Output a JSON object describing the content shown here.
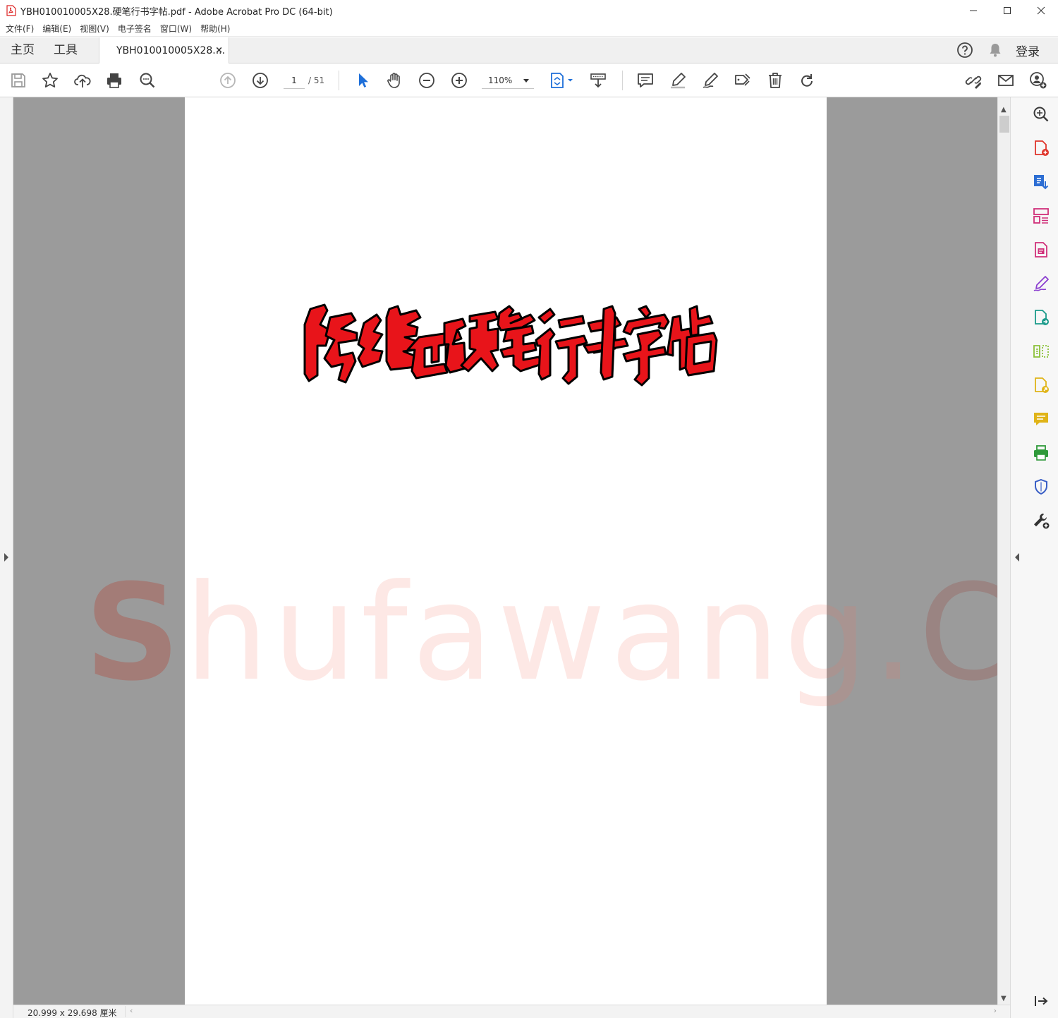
{
  "window": {
    "title": "YBH010010005X28.硬笔行书字帖.pdf - Adobe Acrobat Pro DC (64-bit)",
    "controls": {
      "minimize": "─",
      "maximize": "☐",
      "close": "✕"
    }
  },
  "menu": [
    "文件(F)",
    "编辑(E)",
    "视图(V)",
    "电子签名",
    "窗口(W)",
    "帮助(H)"
  ],
  "tabs": {
    "home": "主页",
    "tools": "工具",
    "document": "YBH010010005X28....",
    "close_glyph": "×",
    "login": "登录"
  },
  "toolbar": {
    "current_page": "1",
    "total_pages": "/ 51",
    "zoom": "110%"
  },
  "document": {
    "title_calligraphy": "陈维世硬笔行书字帖",
    "title_color": "#e8141a"
  },
  "watermark": {
    "first": "S",
    "middle": "hufawang",
    "dot": ".",
    "last": "CN"
  },
  "status": {
    "page_size": "20.999 x 29.698 厘米"
  },
  "scroll": {
    "up": "▲",
    "down": "▼",
    "left": "‹",
    "right": "›"
  },
  "right_pane_tools": [
    {
      "icon": "enhance-scan-icon",
      "color": "#3a3a3a"
    },
    {
      "icon": "create-pdf-icon",
      "color": "#e0352b"
    },
    {
      "icon": "export-pdf-icon",
      "color": "#2d6ed3"
    },
    {
      "icon": "organize-pages-icon",
      "color": "#d0307a"
    },
    {
      "icon": "edit-pdf-icon",
      "color": "#d0307a"
    },
    {
      "icon": "fill-sign-icon",
      "color": "#8b3fd0"
    },
    {
      "icon": "send-for-review-icon",
      "color": "#1a9a8a"
    },
    {
      "icon": "compare-files-icon",
      "color": "#8cc13a"
    },
    {
      "icon": "share-icon",
      "color": "#e0b418"
    },
    {
      "icon": "comment-icon",
      "color": "#e0b418"
    },
    {
      "icon": "print-production-icon",
      "color": "#2f9a3a"
    },
    {
      "icon": "protect-icon",
      "color": "#3a5fc6"
    },
    {
      "icon": "more-tools-icon",
      "color": "#333333"
    }
  ]
}
